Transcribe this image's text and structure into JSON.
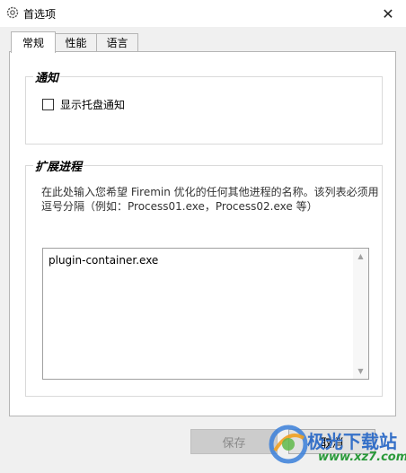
{
  "window": {
    "title": "首选项",
    "close_symbol": "✕"
  },
  "tabs": [
    {
      "label": "常规",
      "active": true
    },
    {
      "label": "性能",
      "active": false
    },
    {
      "label": "语言",
      "active": false
    }
  ],
  "notifications": {
    "group_title": "通知",
    "tray_checkbox_label": "显示托盘通知",
    "tray_checked": false
  },
  "extensions": {
    "group_title": "扩展进程",
    "description": "在此处输入您希望 Firemin 优化的任何其他进程的名称。该列表必须用逗号分隔（例如：Process01.exe，Process02.exe 等）",
    "process_list_value": "plugin-container.exe"
  },
  "buttons": {
    "save_label": "保存",
    "save_enabled": false,
    "cancel_label": "取消"
  },
  "watermark": {
    "text": "极光下载站",
    "url": "www.xz7.com"
  }
}
